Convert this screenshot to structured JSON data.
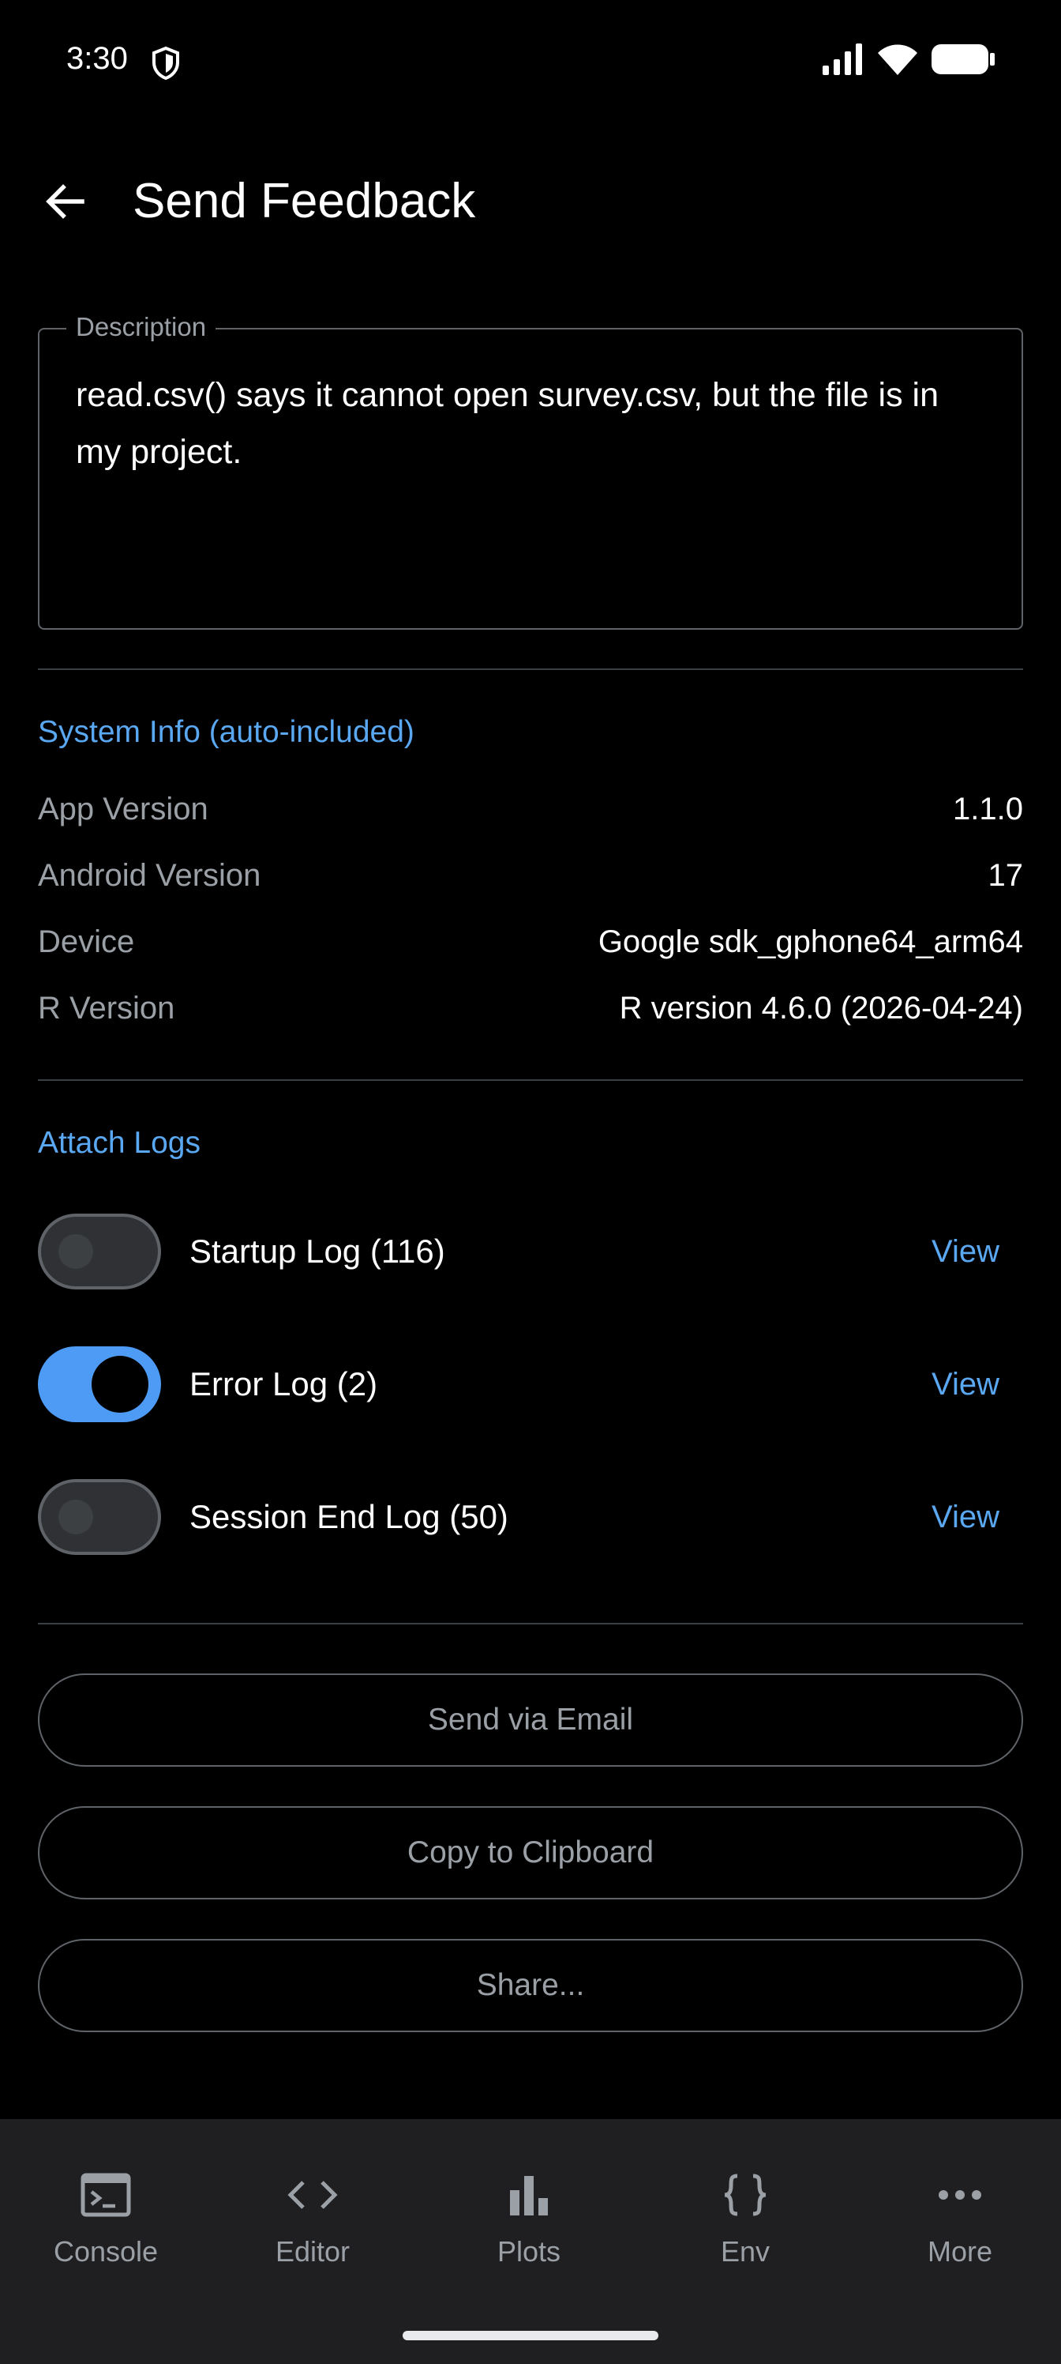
{
  "status": {
    "time": "3:30"
  },
  "app_bar": {
    "title": "Send Feedback"
  },
  "description": {
    "label": "Description",
    "value": "read.csv() says it cannot open survey.csv, but the file is in my project."
  },
  "system_info": {
    "title": "System Info (auto-included)",
    "rows": [
      {
        "label": "App Version",
        "value": "1.1.0"
      },
      {
        "label": "Android Version",
        "value": "17"
      },
      {
        "label": "Device",
        "value": "Google sdk_gphone64_arm64"
      },
      {
        "label": "R Version",
        "value": "R version 4.6.0 (2026-04-24)"
      }
    ]
  },
  "attach_logs": {
    "title": "Attach Logs",
    "view_label": "View",
    "logs": [
      {
        "label": "Startup Log (116)",
        "enabled": false
      },
      {
        "label": "Error Log (2)",
        "enabled": true
      },
      {
        "label": "Session End Log (50)",
        "enabled": false
      }
    ]
  },
  "actions": {
    "email": "Send via Email",
    "clipboard": "Copy to Clipboard",
    "share": "Share..."
  },
  "bottom_nav": {
    "items": [
      {
        "label": "Console",
        "icon": "terminal-icon"
      },
      {
        "label": "Editor",
        "icon": "code-icon"
      },
      {
        "label": "Plots",
        "icon": "bar-chart-icon"
      },
      {
        "label": "Env",
        "icon": "braces-icon"
      },
      {
        "label": "More",
        "icon": "more-horizontal-icon"
      }
    ]
  },
  "colors": {
    "accent": "#5aa7f2",
    "switch_on": "#4d9bf5",
    "background": "#000000",
    "nav_background": "#1f1f21",
    "muted_text": "#9aa0a6"
  }
}
